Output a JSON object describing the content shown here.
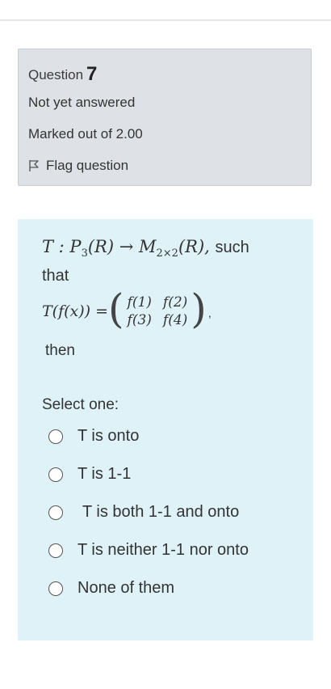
{
  "info": {
    "question_label": "Question",
    "question_number": "7",
    "status": "Not yet answered",
    "marks": "Marked out of 2.00",
    "flag_label": "Flag question"
  },
  "question": {
    "map_text": "T : P",
    "map_sub": "3",
    "map_mid": "(R) → M",
    "map_sub2": "2×2",
    "map_end": "(R),",
    "such": "such",
    "that": "that",
    "lhs": "T(f(x)) =",
    "matrix": [
      "f(1)",
      "f(2)",
      "f(3)",
      "f(4)"
    ],
    "paren_left": "(",
    "paren_right": ")",
    "tail": ",",
    "then": "then",
    "select_one": "Select one:",
    "options": [
      "T is onto",
      "T is 1-1",
      "T is both 1-1 and onto",
      "T is neither 1-1 nor onto",
      "None of them"
    ]
  }
}
